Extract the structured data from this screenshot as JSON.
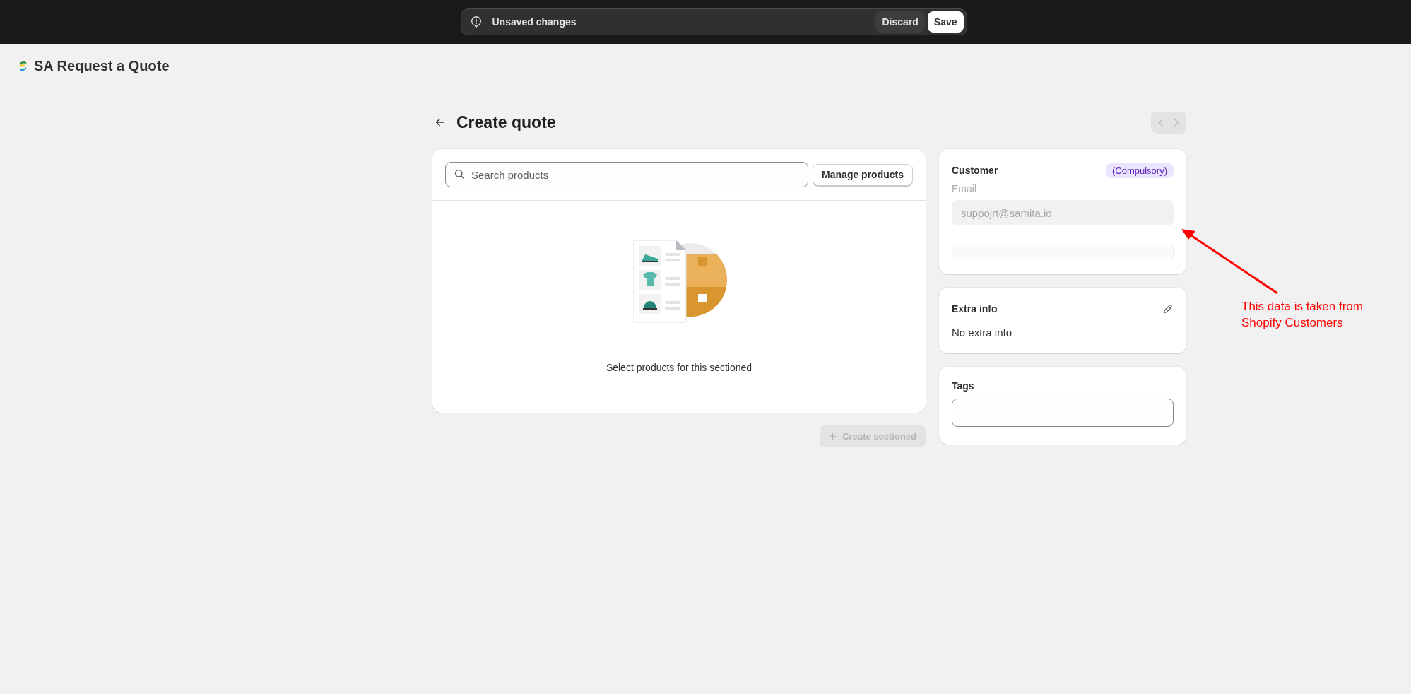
{
  "save_bar": {
    "message": "Unsaved changes",
    "buttons": [
      {
        "label": "Discard",
        "kind": "secondary"
      },
      {
        "label": "Save",
        "kind": "primary"
      }
    ]
  },
  "app_header": {
    "title": "SA Request a Quote"
  },
  "page": {
    "title": "Create quote",
    "pagination": {
      "disabled": true
    }
  },
  "products_card": {
    "search": {
      "placeholder": "Search products"
    },
    "manage_button": "Manage products",
    "empty_message": "Select products for this sectioned"
  },
  "create_button": {
    "label": "Create sectioned",
    "disabled": true
  },
  "customer_card": {
    "title": "Customer",
    "badge": "(Compulsory)",
    "email_label": "Email",
    "email_value": "suppojrt@samita.io",
    "email_disabled": true
  },
  "extra_info_card": {
    "title": "Extra info",
    "text": "No extra info"
  },
  "tags_card": {
    "title": "Tags"
  },
  "annotation": {
    "text": "This data is taken from Shopify Customers"
  }
}
